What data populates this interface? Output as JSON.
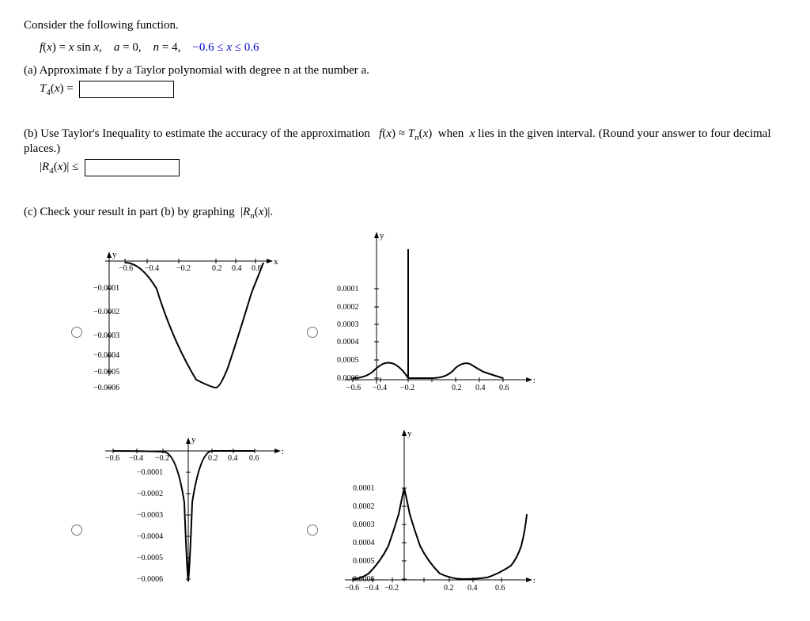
{
  "title": "Consider the following function.",
  "function_def": "f(x) = x sin x,    a = 0,    n = 4,    −0.6 ≤ x ≤ 0.6",
  "part_a_label": "(a) Approximate f by a Taylor polynomial with degree n at the number a.",
  "part_a_input_label": "T₄(x) =",
  "part_b_label": "(b) Use Taylor's Inequality to estimate the accuracy of the approximation  f(x) ≈ Tₙ(x)  when x lies in the given interval. (Round your answer to four decimal places.)",
  "part_b_input_label": "|R₄(x)| ≤",
  "part_c_label": "(c) Check your result in part (b) by graphing  |Rₙ(x)|.",
  "colors": {
    "blue": "#0000cc",
    "black": "#000000"
  }
}
